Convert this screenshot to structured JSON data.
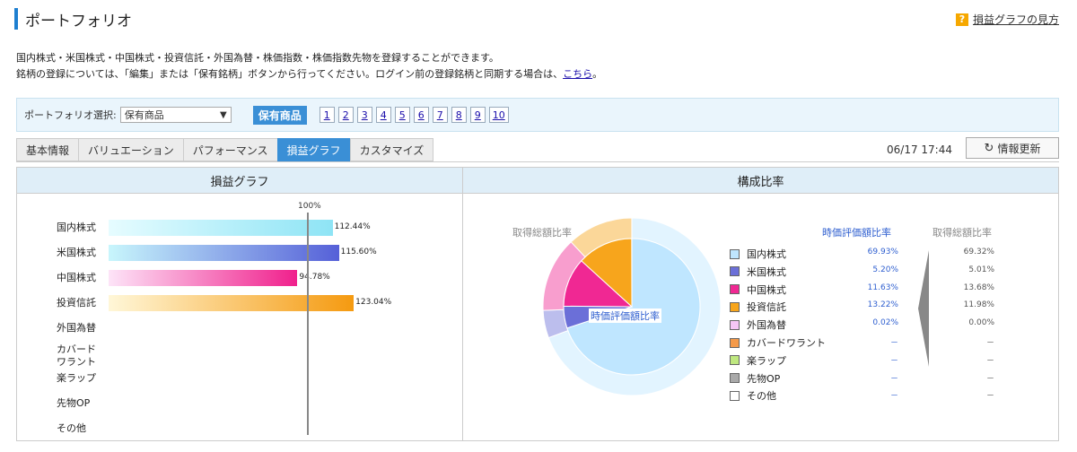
{
  "page": {
    "title": "ポートフォリオ",
    "help_label": "損益グラフの見方",
    "help_icon": "?",
    "description_line1": "国内株式・米国株式・中国株式・投資信託・外国為替・株価指数・株価指数先物を登録することができます。",
    "description_line2": "銘柄の登録については、「編集」または「保有銘柄」ボタンから行ってください。ログイン前の登録銘柄と同期する場合は、",
    "description_link": "こちら",
    "description_end": "。"
  },
  "selector": {
    "label": "ポートフォリオ選択:",
    "selected": "保有商品",
    "active_label": "保有商品",
    "numbers": [
      "1",
      "2",
      "3",
      "4",
      "5",
      "6",
      "7",
      "8",
      "9",
      "10"
    ]
  },
  "tabs": [
    "基本情報",
    "バリュエーション",
    "パフォーマンス",
    "損益グラフ",
    "カスタマイズ"
  ],
  "status": {
    "timestamp": "06/17 17:44",
    "refresh_label": "情報更新",
    "refresh_icon": "↻"
  },
  "left_panel": {
    "heading": "損益グラフ",
    "marker_label": "100%",
    "rows": [
      {
        "label": "国内株式",
        "value": 112.44,
        "value_label": "112.44%",
        "color_from": "#e6fcff",
        "color_to": "#8ee4f5"
      },
      {
        "label": "米国株式",
        "value": 115.6,
        "value_label": "115.60%",
        "color_from": "#c8f6fc",
        "color_to": "#5560d8"
      },
      {
        "label": "中国株式",
        "value": 94.78,
        "value_label": "94.78%",
        "color_from": "#fde4f8",
        "color_to": "#f0208c"
      },
      {
        "label": "投資信託",
        "value": 123.04,
        "value_label": "123.04%",
        "color_from": "#fff7d8",
        "color_to": "#f59a10"
      },
      {
        "label": "外国為替",
        "value": null,
        "value_label": ""
      },
      {
        "label": "カバード\nワラント",
        "value": null,
        "value_label": ""
      },
      {
        "label": "楽ラップ",
        "value": null,
        "value_label": ""
      },
      {
        "label": "先物OP",
        "value": null,
        "value_label": ""
      },
      {
        "label": "その他",
        "value": null,
        "value_label": ""
      }
    ]
  },
  "right_panel": {
    "heading": "構成比率",
    "outer_label": "取得総額比率",
    "inner_label": "時価評価額比率",
    "col_current": "時価評価額比率",
    "col_acquired": "取得総額比率",
    "legend": [
      {
        "label": "国内株式",
        "color": "#bfe6ff",
        "current": "69.93%",
        "acquired": "69.32%"
      },
      {
        "label": "米国株式",
        "color": "#6b6fd8",
        "current": "5.20%",
        "acquired": "5.01%"
      },
      {
        "label": "中国株式",
        "color": "#f02893",
        "current": "11.63%",
        "acquired": "13.68%"
      },
      {
        "label": "投資信託",
        "color": "#f7a51c",
        "current": "13.22%",
        "acquired": "11.98%"
      },
      {
        "label": "外国為替",
        "color": "#f5c6f5",
        "current": "0.02%",
        "acquired": "0.00%"
      },
      {
        "label": "カバードワラント",
        "color": "#f49a4a",
        "current": "－",
        "acquired": "－"
      },
      {
        "label": "楽ラップ",
        "color": "#bfe880",
        "current": "－",
        "acquired": "－"
      },
      {
        "label": "先物OP",
        "color": "#a9a9a9",
        "current": "－",
        "acquired": "－"
      },
      {
        "label": "その他",
        "color": "#ffffff",
        "current": "－",
        "acquired": "－"
      }
    ]
  }
}
